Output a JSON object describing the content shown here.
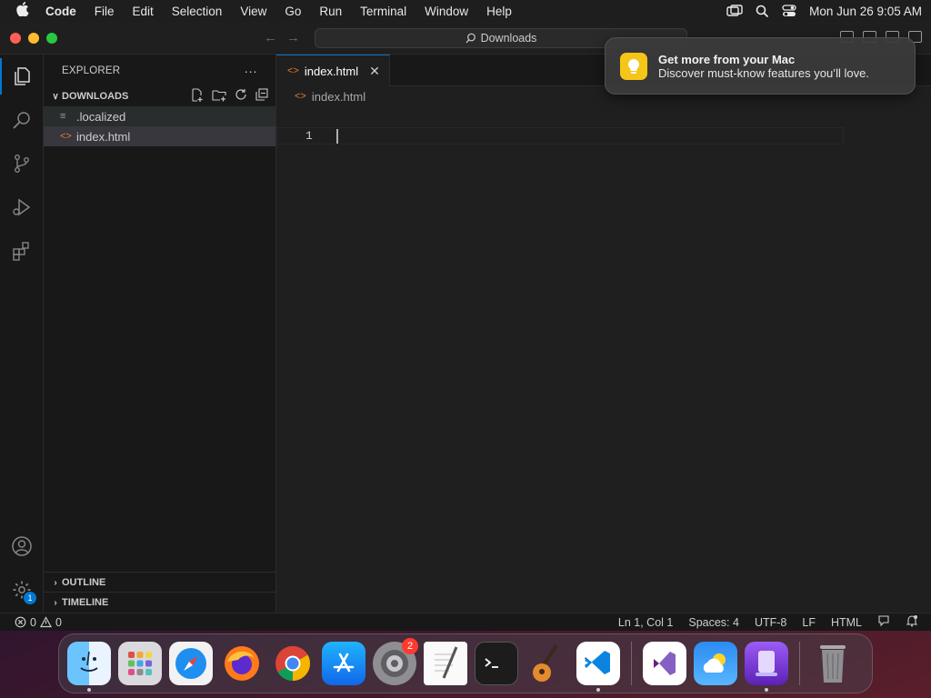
{
  "menubar": {
    "app_name": "Code",
    "items": [
      "File",
      "Edit",
      "Selection",
      "View",
      "Go",
      "Run",
      "Terminal",
      "Window",
      "Help"
    ],
    "clock": "Mon Jun 26  9:05 AM"
  },
  "titlebar": {
    "search_label": "Downloads"
  },
  "sidebar": {
    "title": "EXPLORER",
    "more": "···",
    "folder": "DOWNLOADS",
    "files": [
      ".localized",
      "index.html"
    ],
    "outline": "OUTLINE",
    "timeline": "TIMELINE"
  },
  "activity": {
    "settings_badge": "1"
  },
  "editor": {
    "tab_label": "index.html",
    "breadcrumb": "index.html",
    "line_number": "1"
  },
  "statusbar": {
    "errors": "0",
    "warnings": "0",
    "position": "Ln 1, Col 1",
    "spaces": "Spaces: 4",
    "encoding": "UTF-8",
    "eol": "LF",
    "language": "HTML"
  },
  "notification": {
    "title": "Get more from your Mac",
    "body": "Discover must-know features you’ll love."
  },
  "dock": {
    "settings_badge": "2",
    "apps": [
      "finder",
      "launchpad",
      "safari",
      "firefox",
      "chrome",
      "app-store",
      "system-settings",
      "textedit",
      "terminal",
      "garageband",
      "vscode",
      "visual-studio",
      "weather",
      "simulator",
      "trash"
    ]
  }
}
